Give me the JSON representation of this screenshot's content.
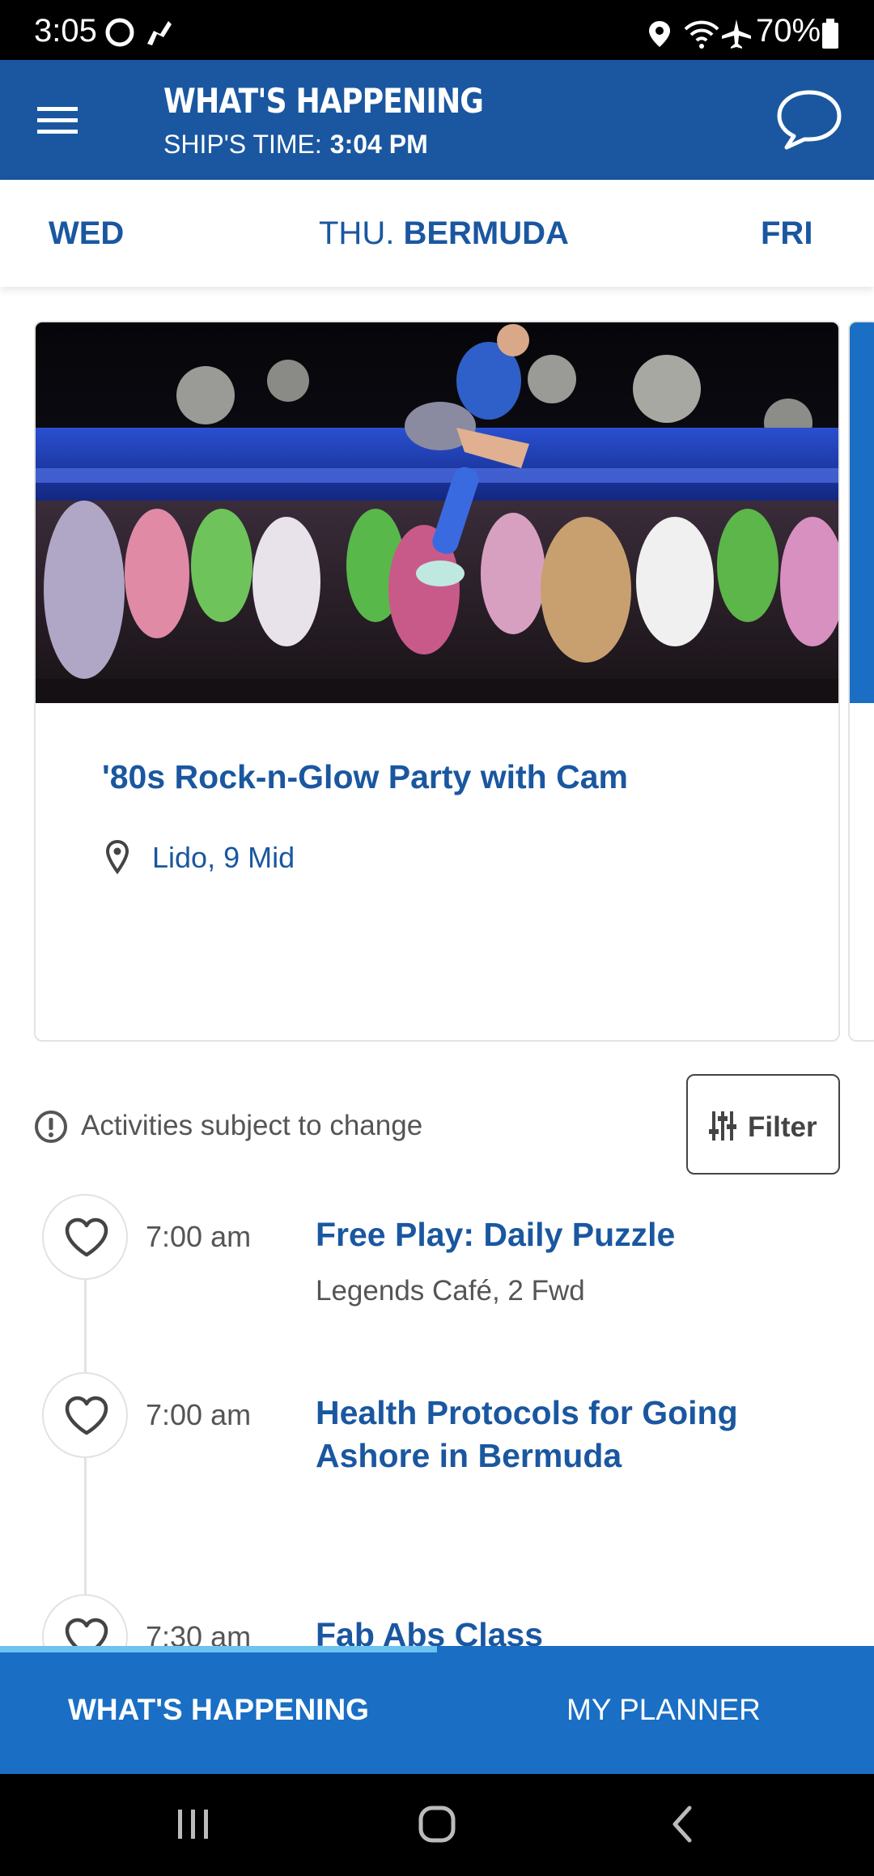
{
  "status_bar": {
    "time": "3:05",
    "battery": "70%",
    "icons": [
      "circle-icon",
      "notification-icon",
      "location-icon",
      "wifi-icon",
      "airplane-icon",
      "battery-icon"
    ]
  },
  "header": {
    "title": "WHAT'S HAPPENING",
    "ship_time_label": "SHIP'S TIME:",
    "ship_time_value": "3:04 PM",
    "menu_icon": "hamburger-icon",
    "chat_icon": "chat-bubble-icon"
  },
  "day_tabs": {
    "prev": "WED",
    "current_day": "THU.",
    "current_place": "BERMUDA",
    "next": "FRI"
  },
  "featured": {
    "title": "'80s Rock-n-Glow Party with Cam",
    "location": "Lido, 9 Mid"
  },
  "notice": {
    "text": "Activities subject to change"
  },
  "filter": {
    "label": "Filter"
  },
  "activities": [
    {
      "time": "7:00 am",
      "title": "Free Play: Daily Puzzle",
      "location": "Legends Café, 2 Fwd"
    },
    {
      "time": "7:00 am",
      "title": "Health Protocols for Going Ashore in Bermuda",
      "location": ""
    },
    {
      "time": "7:30 am",
      "title": "Fab Abs Class",
      "location": ""
    }
  ],
  "bottom_tabs": {
    "active": "WHAT'S HAPPENING",
    "inactive": "MY PLANNER"
  },
  "colors": {
    "brand_blue": "#1a57a0",
    "tab_bar_blue": "#1a6fc4",
    "indicator": "#6cc3f0"
  }
}
